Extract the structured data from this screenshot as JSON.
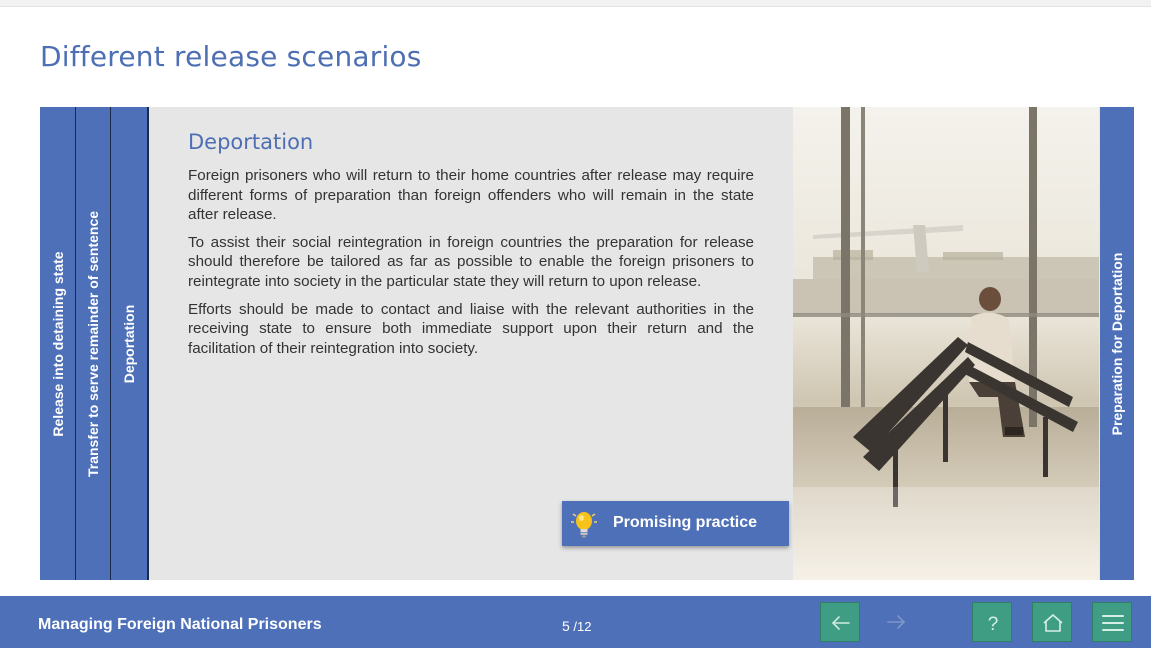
{
  "page": {
    "title": "Different release scenarios"
  },
  "tabs": {
    "left": [
      {
        "label": "Release into detaining state"
      },
      {
        "label": "Transfer to serve remainder of sentence"
      },
      {
        "label": "Deportation"
      }
    ],
    "right": {
      "label": "Preparation for Deportation"
    }
  },
  "panel": {
    "heading": "Deportation",
    "paragraphs": [
      "Foreign prisoners who will return to their home countries after release may require different forms of preparation than foreign offenders who will remain in the state after release.",
      "To assist their social reintegration in foreign countries the preparation for release should therefore be tailored as far as possible to enable the foreign prisoners to reintegrate into society in the particular state they will return to upon release.",
      "Efforts should be made to contact and liaise with the relevant authorities in the receiving state to ensure both immediate support upon their return and the facilitation of their reintegration into society."
    ],
    "promising_button": {
      "label": "Promising practice",
      "icon": "lightbulb-icon"
    }
  },
  "footer": {
    "course_title": "Managing Foreign National Prisoners",
    "page_current": "5",
    "page_total": "12",
    "buttons": {
      "back": {
        "icon": "arrow-left-icon"
      },
      "forward": {
        "icon": "arrow-right-icon",
        "disabled": true
      },
      "help": {
        "icon": "question-mark-icon",
        "glyph": "?"
      },
      "home": {
        "icon": "home-icon"
      },
      "menu": {
        "icon": "hamburger-menu-icon"
      }
    }
  },
  "colors": {
    "accent_blue": "#4e70b8",
    "title_blue": "#4e6fb3",
    "nav_green": "#3f9d84",
    "panel_gray": "#e6e6e6"
  }
}
